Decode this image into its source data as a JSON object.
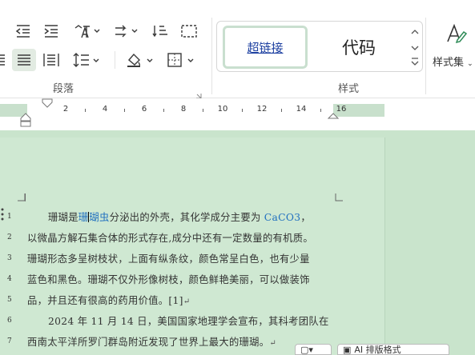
{
  "ribbon": {
    "paragraph_group_label": "段落",
    "styles_group_label": "样式",
    "styles": [
      {
        "label": "超链接"
      },
      {
        "label": "代码"
      }
    ],
    "style_set_label": "样式集",
    "icons": {
      "row1": [
        "decrease-indent-icon",
        "increase-indent-icon",
        "text-direction-icon",
        "line-break-direction-icon",
        "sort-icon",
        "show-hide-marks-icon"
      ],
      "row2": [
        "align-justify-icon",
        "distributed-align-icon",
        "line-spacing-icon",
        "shading-icon",
        "borders-icon"
      ]
    }
  },
  "ruler": {
    "numbers": [
      "2",
      "4",
      "6",
      "8",
      "10",
      "12",
      "14",
      "16"
    ]
  },
  "document": {
    "lines": [
      {
        "num": "1",
        "parts": [
          {
            "t": "珊瑚是",
            "c": ""
          },
          {
            "t": "珊",
            "c": "hl"
          },
          {
            "t": "|",
            "c": "caret"
          },
          {
            "t": "瑚虫",
            "c": "hl"
          },
          {
            "t": "分泌出的外壳，其化学成分主要为 ",
            "c": ""
          },
          {
            "t": "CaCO3",
            "c": "hl"
          },
          {
            "t": "，",
            "c": ""
          }
        ]
      },
      {
        "num": "2",
        "parts": [
          {
            "t": "以微晶方解石集合体的形式存在,成分中还有一定数量的有机质。",
            "c": ""
          }
        ]
      },
      {
        "num": "3",
        "parts": [
          {
            "t": "珊瑚形态多呈树枝状，上面有纵条纹，颜色常呈白色，也有少量",
            "c": ""
          }
        ]
      },
      {
        "num": "4",
        "parts": [
          {
            "t": "蓝色和黑色。珊瑚不仅外形像树枝，颜色鲜艳美丽，可以做装饰",
            "c": ""
          }
        ]
      },
      {
        "num": "5",
        "parts": [
          {
            "t": "品，并且还有很高的药用价值。",
            "c": ""
          },
          {
            "t": "[1]",
            "c": ""
          },
          {
            "t": "↵",
            "c": "para"
          }
        ]
      },
      {
        "num": "6",
        "parts": [
          {
            "t": "2024 年 11 月 14 日，美国国家地理学会宣布，其科考团队在",
            "c": ""
          }
        ]
      },
      {
        "num": "7",
        "parts": [
          {
            "t": "西南太平洋所罗门群岛附近发现了世界上最大的珊瑚。",
            "c": ""
          },
          {
            "t": "↵",
            "c": "para"
          }
        ]
      }
    ]
  },
  "bottom": {
    "ai_button": "AI 排版格式"
  }
}
